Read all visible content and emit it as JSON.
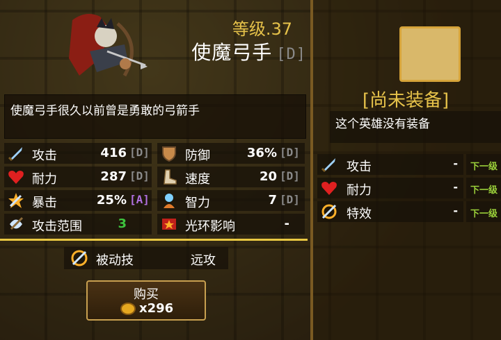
{
  "hero": {
    "level_text": "等级.37",
    "name": "使魔弓手",
    "name_grade": "[D]",
    "description": "使魔弓手很久以前曾是勇敢的弓箭手"
  },
  "stats": [
    {
      "label": "攻击",
      "value": "416",
      "grade": "[D]",
      "icon": "sword-icon"
    },
    {
      "label": "防御",
      "value": "36%",
      "grade": "[D]",
      "icon": "shield-icon"
    },
    {
      "label": "耐力",
      "value": "287",
      "grade": "[D]",
      "icon": "heart-icon"
    },
    {
      "label": "速度",
      "value": "20",
      "grade": "[D]",
      "icon": "boot-icon"
    },
    {
      "label": "暴击",
      "value": "25%",
      "grade": "[A]",
      "icon": "crit-icon"
    },
    {
      "label": "智力",
      "value": "7",
      "grade": "[D]",
      "icon": "intellect-icon"
    },
    {
      "label": "攻击范围",
      "value": "3",
      "grade": "",
      "icon": "range-icon"
    },
    {
      "label": "光环影响",
      "value": "-",
      "grade": "",
      "icon": "aura-icon"
    }
  ],
  "passive": {
    "label": "被动技",
    "value": "远攻",
    "icon": "passive-skill-icon"
  },
  "buy": {
    "label": "购买",
    "price": "x296",
    "icon": "coin-icon"
  },
  "equipment": {
    "status": "[尚未装备]",
    "note": "这个英雄没有装备",
    "stats": [
      {
        "label": "攻击",
        "value": "-",
        "next": "下一级",
        "icon": "sword-icon"
      },
      {
        "label": "耐力",
        "value": "-",
        "next": "下一级",
        "icon": "heart-icon"
      },
      {
        "label": "特效",
        "value": "-",
        "next": "下一级",
        "icon": "effect-icon"
      }
    ]
  },
  "colors": {
    "gold": "#e6c24a",
    "grade_gray": "#8a8a8a",
    "grade_a": "#b070e0",
    "green": "#3ec43e",
    "next_green": "#9bd13a"
  }
}
